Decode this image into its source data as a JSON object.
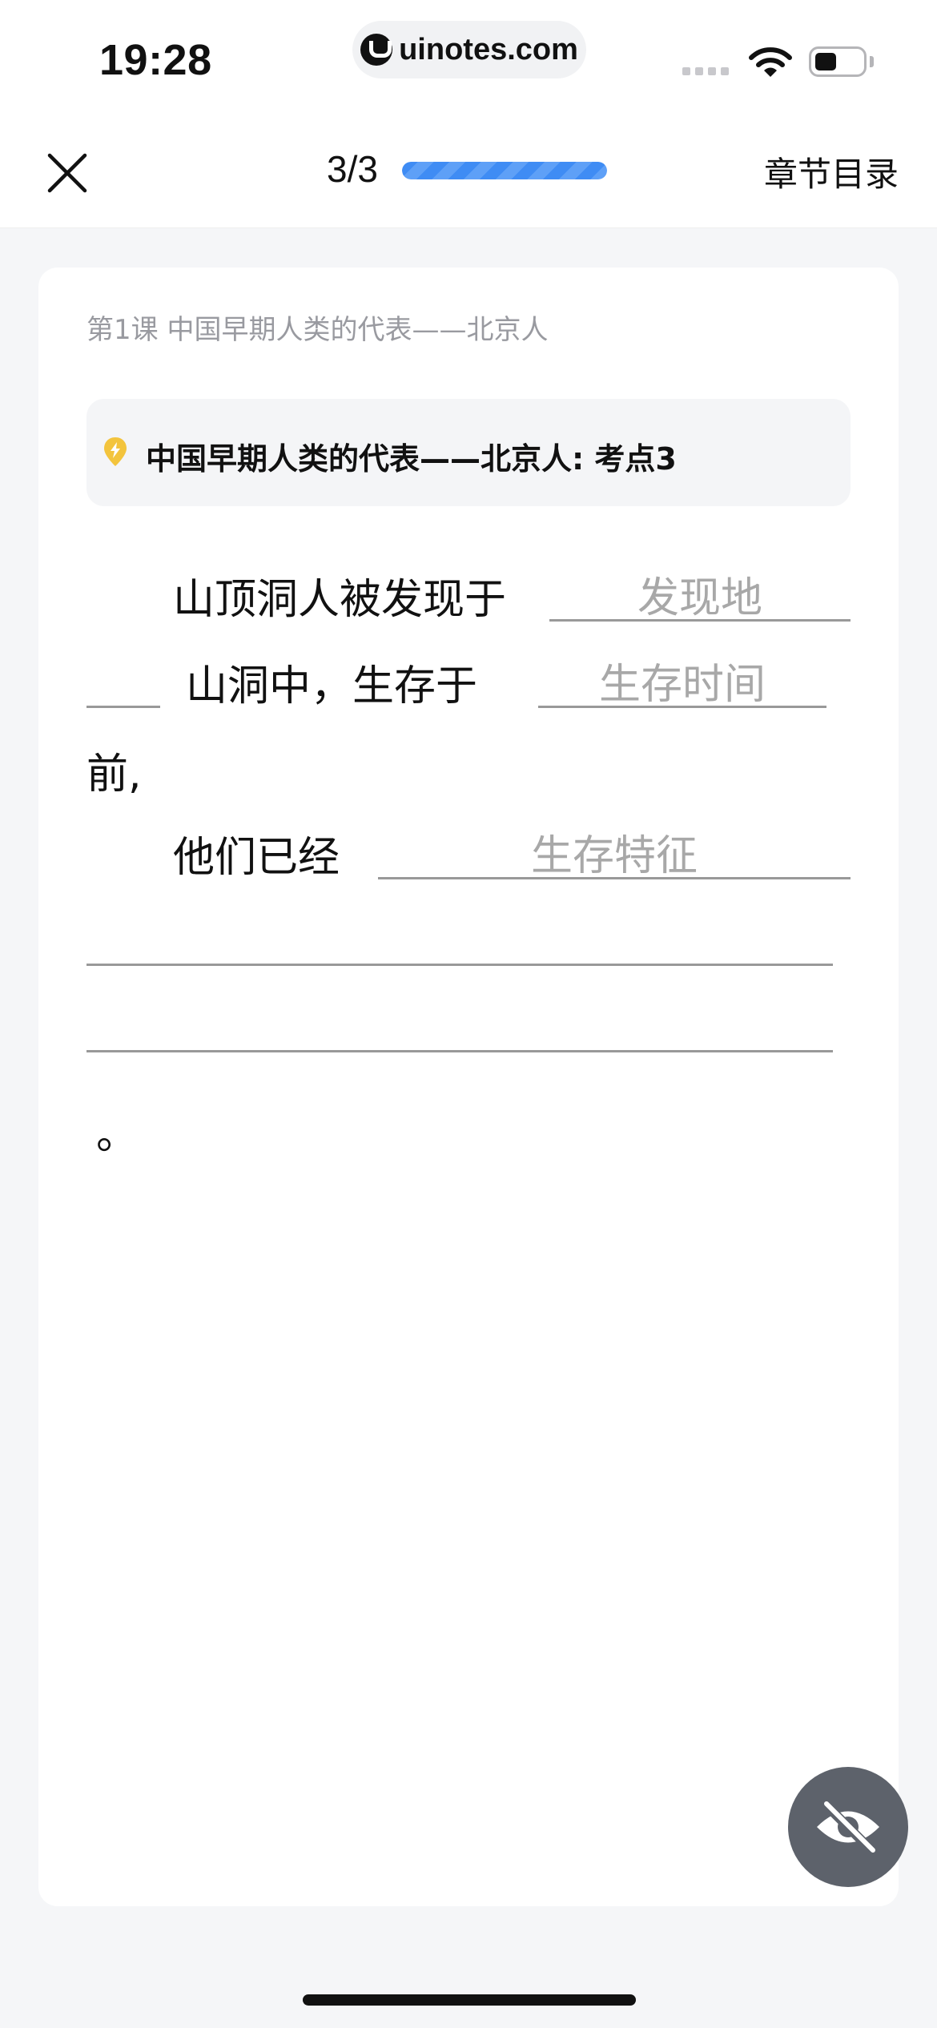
{
  "status_bar": {
    "time": "19:28",
    "url": "uinotes.com",
    "icons": [
      "uinotes-logo-icon",
      "cellular-signal-icon",
      "wifi-icon",
      "battery-icon"
    ]
  },
  "nav": {
    "progress_text": "3/3",
    "progress_fraction": 1.0,
    "toc_label": "章节目录",
    "close_icon": "close-icon"
  },
  "card": {
    "lesson_title": "第1课 中国早期人类的代表——北京人",
    "point_icon": "lightning-badge-icon",
    "point_title": "中国早期人类的代表——北京人: 考点3",
    "line1_text": "山顶洞人被发现于",
    "blank_location": "发现地",
    "line2_text": "山洞中，生存于",
    "blank_time": "生存时间",
    "line3_text": "前,",
    "line4_text": "他们已经",
    "blank_features": "生存特征",
    "period": "。"
  },
  "eye_button": {
    "icon": "eye-off-icon"
  },
  "colors": {
    "accent": "#3f8cf4",
    "badge": "#f3c43d",
    "fab": "#5d626b",
    "placeholder": "#a8a8a8"
  }
}
